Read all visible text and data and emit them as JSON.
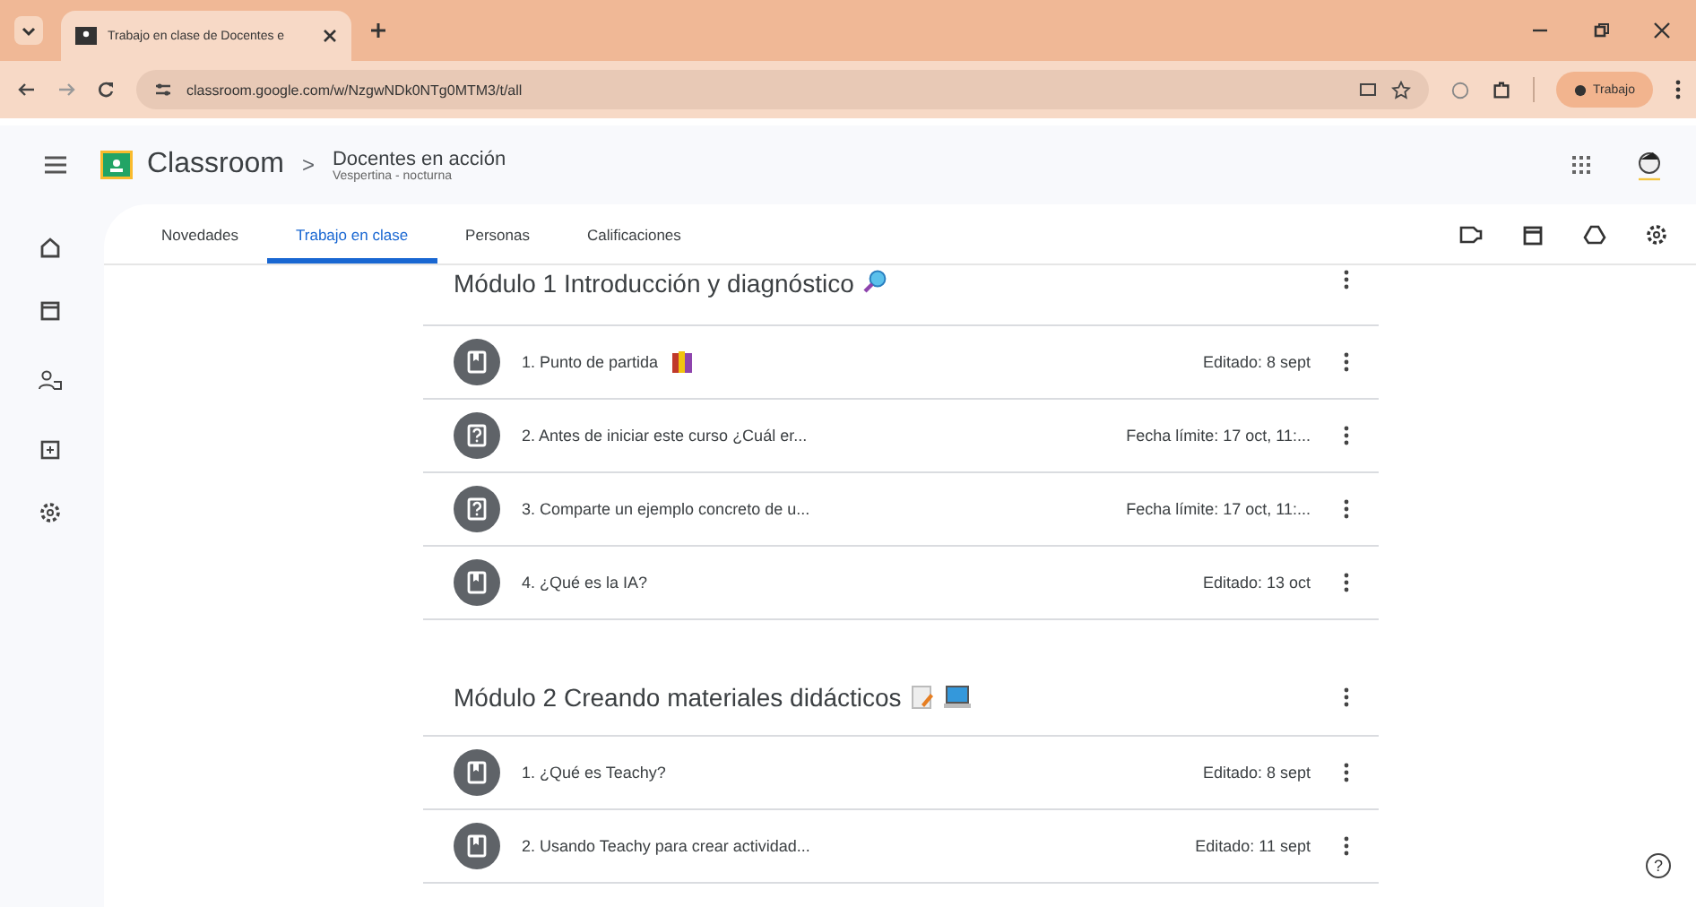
{
  "browser": {
    "tab_title": "Trabajo en clase de Docentes e",
    "url": "classroom.google.com/w/NzgwNDk0NTg0MTM3/t/all",
    "profile": "Trabajo"
  },
  "header": {
    "app": "Classroom",
    "separator": ">",
    "class_name": "Docentes en acción",
    "section": "Vespertina - nocturna"
  },
  "tabs": [
    {
      "label": "Novedades",
      "selected": false
    },
    {
      "label": "Trabajo en clase",
      "selected": true
    },
    {
      "label": "Personas",
      "selected": false
    },
    {
      "label": "Calificaciones",
      "selected": false
    }
  ],
  "modules": [
    {
      "title": "Módulo 1 Introducción y diagnóstico",
      "items": [
        {
          "kind": "material",
          "title": "1. Punto de partida",
          "meta": "Editado: 8 sept"
        },
        {
          "kind": "question",
          "title": "2. Antes de iniciar este curso ¿Cuál er...",
          "meta": "Fecha límite: 17 oct, 11:..."
        },
        {
          "kind": "question",
          "title": "3. Comparte un ejemplo concreto de u...",
          "meta": "Fecha límite: 17 oct, 11:..."
        },
        {
          "kind": "material",
          "title": "4. ¿Qué es la IA?",
          "meta": "Editado: 13 oct"
        }
      ]
    },
    {
      "title": "Módulo 2 Creando materiales didácticos",
      "items": [
        {
          "kind": "material",
          "title": "1. ¿Qué es Teachy?",
          "meta": "Editado: 8 sept"
        },
        {
          "kind": "material",
          "title": "2. Usando Teachy para crear actividad...",
          "meta": "Editado: 11 sept"
        }
      ]
    }
  ],
  "help": "?"
}
